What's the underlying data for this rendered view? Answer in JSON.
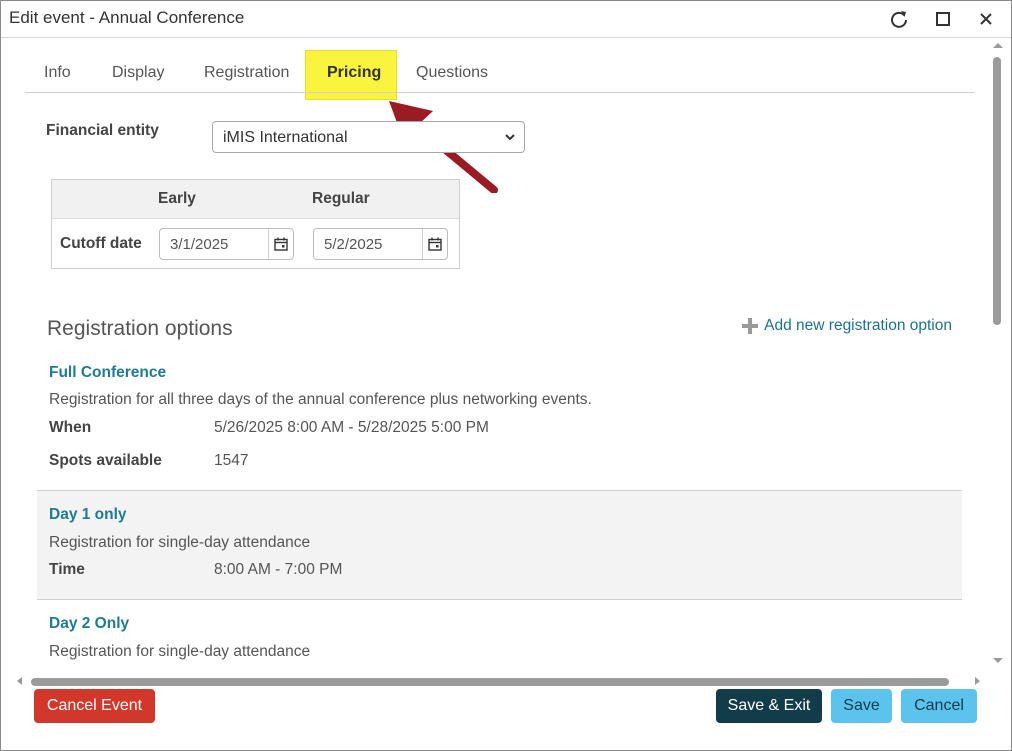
{
  "window": {
    "title": "Edit event - Annual Conference",
    "refresh_icon": "refresh-icon",
    "maximize_icon": "maximize-icon",
    "close_icon": "close-icon"
  },
  "tabs": [
    {
      "label": "Info"
    },
    {
      "label": "Display"
    },
    {
      "label": "Registration"
    },
    {
      "label": "Pricing",
      "active": true
    },
    {
      "label": "Questions"
    }
  ],
  "financial_entity": {
    "label": "Financial entity",
    "value": "iMIS International"
  },
  "cutoff": {
    "col_early": "Early",
    "col_regular": "Regular",
    "row_label": "Cutoff date",
    "early_value": "3/1/2025",
    "regular_value": "5/2/2025"
  },
  "registration": {
    "section_title": "Registration options",
    "add_label": "Add new registration option",
    "options": [
      {
        "name": "Full Conference",
        "description": "Registration for all three days of the annual conference plus networking events.",
        "when_label": "When",
        "when_value": "5/26/2025 8:00 AM - 5/28/2025 5:00 PM",
        "spots_label": "Spots available",
        "spots_value": "1547"
      },
      {
        "name": "Day 1 only",
        "description": "Registration for single-day attendance",
        "time_label": "Time",
        "time_value": "8:00 AM - 7:00 PM"
      },
      {
        "name": "Day 2 Only",
        "description": "Registration for single-day attendance"
      }
    ]
  },
  "footer": {
    "cancel_event": "Cancel Event",
    "save_exit": "Save & Exit",
    "save": "Save",
    "cancel": "Cancel"
  },
  "colors": {
    "highlight": "#fbf43f",
    "arrow": "#9b1b24",
    "link": "#1f7a96",
    "danger": "#d2372b",
    "primary_dark": "#123c4a",
    "primary_light": "#5cc3ec"
  }
}
